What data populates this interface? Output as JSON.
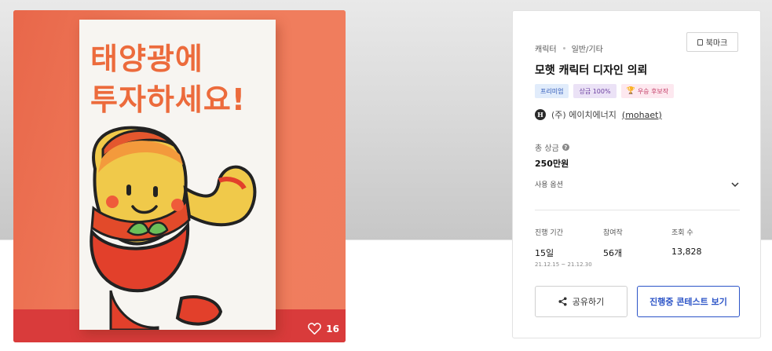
{
  "hero": {
    "slogan_line1": "태양광에",
    "slogan_line2": "투자하세요!",
    "likes": "16"
  },
  "contest": {
    "category": "캐릭터",
    "subcategory": "일반/기타",
    "bookmark_label": "북마크",
    "title": "모햇 캐릭터 디자인 의뢰",
    "badges": {
      "premium": "프리미엄",
      "prize_rate": "상금 100%",
      "excellent": "우승 후보작"
    },
    "host": {
      "logo_letter": "H",
      "name": "(주) 에이치에너지",
      "handle": "(mohaet)"
    },
    "prize": {
      "label": "총 상금",
      "value": "250만원"
    },
    "options_label": "사용 옵션",
    "stats": {
      "period_label": "진행 기간",
      "period_value": "15일",
      "period_dates": "21.12.15 ~ 21.12.30",
      "entries_label": "참여작",
      "entries_value": "56개",
      "views_label": "조회 수",
      "views_value": "13,828"
    },
    "share_label": "공유하기",
    "view_label": "진행중 콘테스트 보기"
  },
  "colors": {
    "accent": "#2c54c7",
    "hero_bg": "#ef7a58",
    "slogan": "#ec6b3c"
  },
  "icons": [
    "heart-icon",
    "bookmark-icon",
    "help-icon",
    "chevron-down-icon",
    "share-icon",
    "trophy-icon"
  ]
}
